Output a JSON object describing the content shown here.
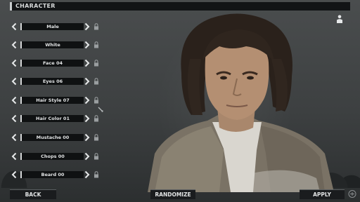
{
  "header": {
    "title": "CHARACTER"
  },
  "options": [
    {
      "label": "Male"
    },
    {
      "label": "White"
    },
    {
      "label": "Face 04"
    },
    {
      "label": "Eyes 06"
    },
    {
      "label": "Hair Style 07"
    },
    {
      "label": "Hair Color 01",
      "has_color_picker": true
    },
    {
      "label": "Mustache 00"
    },
    {
      "label": "Chops 00"
    },
    {
      "label": "Beard 00"
    }
  ],
  "buttons": {
    "back": "BACK",
    "randomize": "RANDOMIZE",
    "apply": "APPLY"
  },
  "icons": {
    "prev": "chevron-left-icon",
    "next": "chevron-right-icon",
    "lock": "lock-icon",
    "color_picker": "color-picker-icon",
    "character": "person-icon",
    "controller": "gamepad-icon"
  },
  "colors": {
    "panel": "#0f1112",
    "text": "#e1e3e4",
    "accent": "#d4d6d7"
  }
}
